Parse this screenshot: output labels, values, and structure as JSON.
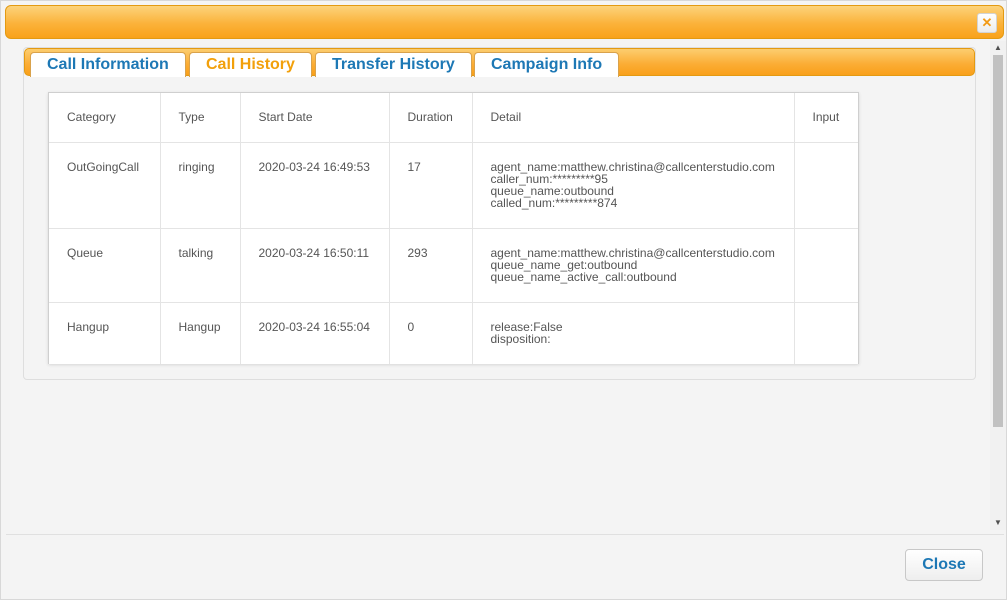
{
  "window": {
    "close_icon": "close-x-icon"
  },
  "tabs": [
    {
      "label": "Call Information",
      "active": false
    },
    {
      "label": "Call History",
      "active": true
    },
    {
      "label": "Transfer History",
      "active": false
    },
    {
      "label": "Campaign Info",
      "active": false
    }
  ],
  "table": {
    "headers": [
      "Category",
      "Type",
      "Start Date",
      "Duration",
      "Detail",
      "Input"
    ],
    "rows": [
      {
        "category": "OutGoingCall",
        "type": "ringing",
        "start_date": "2020-03-24 16:49:53",
        "duration": "17",
        "detail": [
          "agent_name:matthew.christina@callcenterstudio.com",
          "caller_num:*********95",
          "queue_name:outbound",
          "called_num:*********874"
        ],
        "input": ""
      },
      {
        "category": "Queue",
        "type": "talking",
        "start_date": "2020-03-24 16:50:11",
        "duration": "293",
        "detail": [
          "agent_name:matthew.christina@callcenterstudio.com",
          "queue_name_get:outbound",
          "queue_name_active_call:outbound"
        ],
        "input": ""
      },
      {
        "category": "Hangup",
        "type": "Hangup",
        "start_date": "2020-03-24 16:55:04",
        "duration": "0",
        "detail": [
          "release:False",
          "disposition:"
        ],
        "input": ""
      }
    ]
  },
  "footer": {
    "close_label": "Close"
  },
  "colors": {
    "accent": "#f9a01a",
    "link": "#1d78b5",
    "active_tab": "#f2a00b"
  }
}
